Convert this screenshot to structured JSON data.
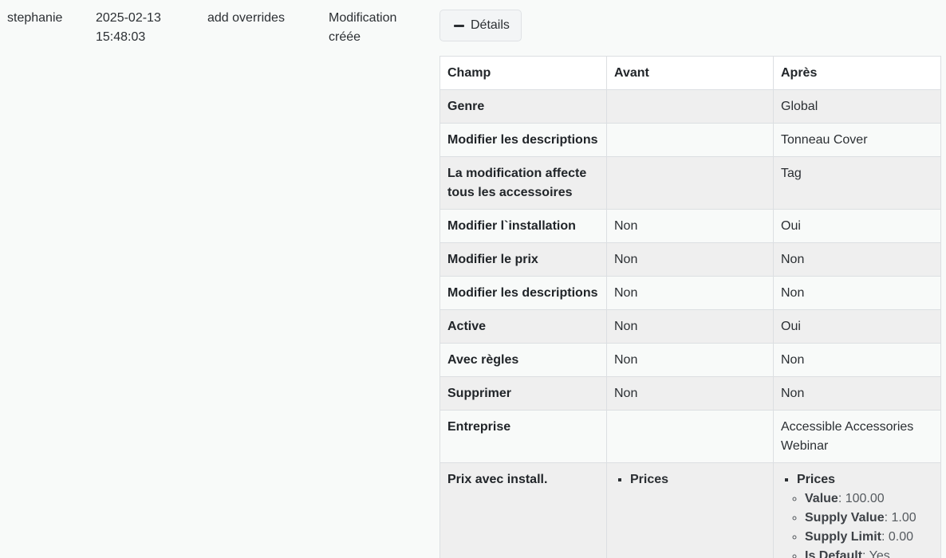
{
  "entry": {
    "user": "stephanie",
    "date": "2025-02-13",
    "time": "15:48:03",
    "message": "add overrides",
    "type_line1": "Modification",
    "type_line2": "créée"
  },
  "details_button": {
    "label": "Détails",
    "icon": "minus-icon"
  },
  "table": {
    "headers": [
      "Champ",
      "Avant",
      "Après"
    ],
    "rows": [
      {
        "field": "Genre",
        "before": "",
        "after": "Global"
      },
      {
        "field": "Modifier les descriptions",
        "before": "",
        "after": "Tonneau Cover"
      },
      {
        "field": "La modification affecte tous les accessoires",
        "before": "",
        "after": "Tag"
      },
      {
        "field": "Modifier l`installation",
        "before": "Non",
        "after": "Oui"
      },
      {
        "field": "Modifier le prix",
        "before": "Non",
        "after": "Non"
      },
      {
        "field": "Modifier les descriptions",
        "before": "Non",
        "after": "Non"
      },
      {
        "field": "Active",
        "before": "Non",
        "after": "Oui"
      },
      {
        "field": "Avec règles",
        "before": "Non",
        "after": "Non"
      },
      {
        "field": "Supprimer",
        "before": "Non",
        "after": "Non"
      },
      {
        "field": "Entreprise",
        "before": "",
        "after": "Accessible Accessories Webinar"
      }
    ],
    "prices_row": {
      "field": "Prix avec install.",
      "before_heading": "Prices",
      "after_heading": "Prices",
      "after_items": [
        {
          "key": "Value",
          "value": "100.00"
        },
        {
          "key": "Supply Value",
          "value": "1.00"
        },
        {
          "key": "Supply Limit",
          "value": "0.00"
        },
        {
          "key": "Is Default",
          "value": "Yes"
        }
      ]
    }
  }
}
